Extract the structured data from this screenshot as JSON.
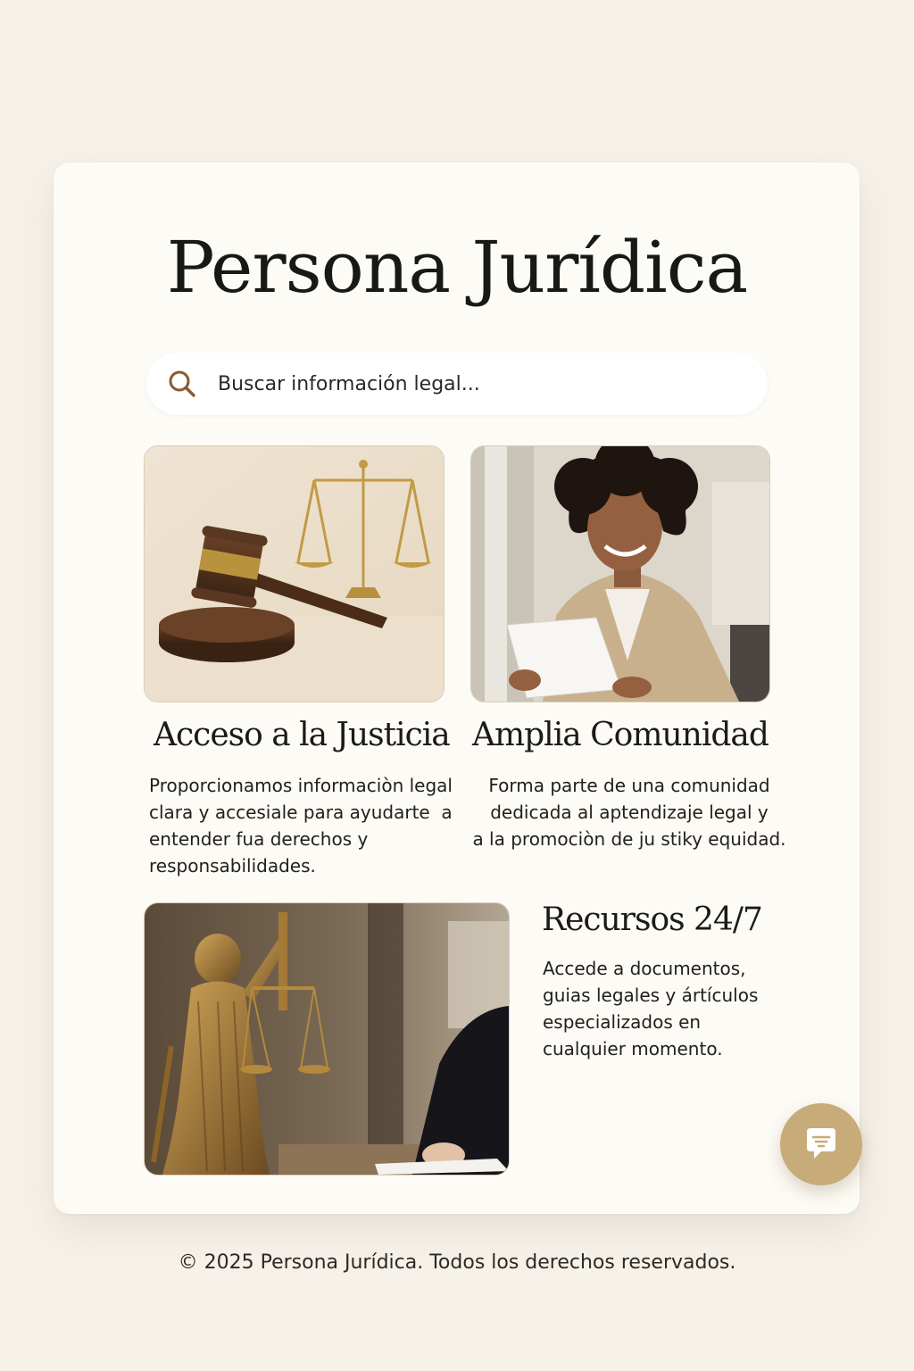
{
  "colors": {
    "background": "#f6f1e9",
    "card": "#fdfbf6",
    "accent": "#c7ab79",
    "icon_brown": "#8a5a2b"
  },
  "header": {
    "title": "Persona Jurídica"
  },
  "search": {
    "placeholder": "Buscar información legal...",
    "icon": "search-icon"
  },
  "features": [
    {
      "image": "gavel-and-scales-photo",
      "title": "Acceso a la Justicia",
      "lines": [
        "Proporcionamos informaciòn legal",
        "clara y accesiale para ayudarte  a",
        "entender fua derechos y",
        "responsabilidades."
      ]
    },
    {
      "image": "smiling-woman-reading-document-photo",
      "title": "Amplia Comunidad",
      "lines": [
        "Forma parte de una comunidad",
        "dedicada al aptendizaje legal y",
        "a la promociòn de ju stiky equidad."
      ]
    },
    {
      "image": "lady-justice-statue-photo",
      "title": "Recursos 24/7",
      "lines": [
        "Accede a documentos,",
        "guias legales y ártículos",
        "especializados en",
        "cualquier momento."
      ]
    }
  ],
  "chat_button": {
    "icon": "chat-bubble-icon"
  },
  "footer": {
    "text": "© 2025 Persona Jurídica. Todos los derechos reservados."
  }
}
